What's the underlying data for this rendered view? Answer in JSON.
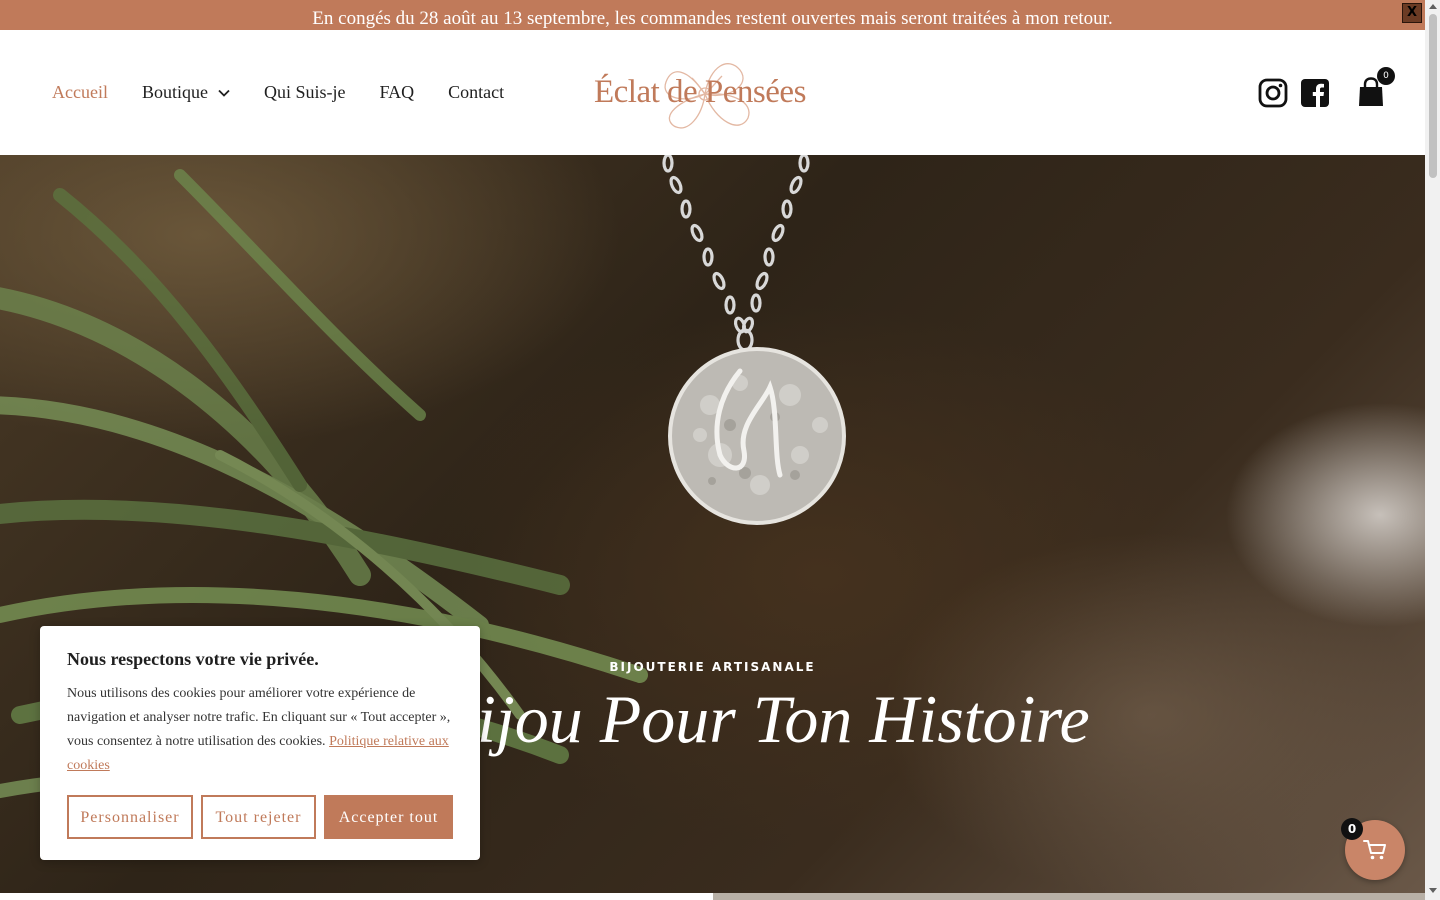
{
  "announcement": {
    "text": "En congés du 28 août au 13 septembre, les commandes restent ouvertes mais seront traitées à mon retour.",
    "close_label": "X"
  },
  "nav": {
    "items": [
      {
        "label": "Accueil",
        "active": true
      },
      {
        "label": "Boutique",
        "has_submenu": true
      },
      {
        "label": "Qui Suis-je"
      },
      {
        "label": "FAQ"
      },
      {
        "label": "Contact"
      }
    ]
  },
  "brand": {
    "name": "Éclat de Pensées",
    "logo_icon": "flower-icon"
  },
  "header_icons": {
    "instagram": "instagram-icon",
    "facebook": "facebook-icon",
    "cart": "shopping-bag-icon",
    "cart_count": "0"
  },
  "hero": {
    "eyebrow": "BIJOUTERIE ARTISANALE",
    "title": "Un Bijou Pour Ton Histoire"
  },
  "cookie": {
    "title": "Nous respectons votre vie privée.",
    "body": "Nous utilisons des cookies pour améliorer votre expérience de navigation et analyser notre trafic. En cliquant sur « Tout accepter », vous consentez à notre utilisation des cookies.",
    "policy_link": "Politique relative aux cookies",
    "buttons": {
      "customize": "Personnaliser",
      "reject": "Tout rejeter",
      "accept": "Accepter tout"
    }
  },
  "floating_cart": {
    "count": "0",
    "icon": "cart-icon"
  },
  "colors": {
    "accent": "#c07a5a",
    "text": "#1f1f1f",
    "badge": "#111111"
  }
}
